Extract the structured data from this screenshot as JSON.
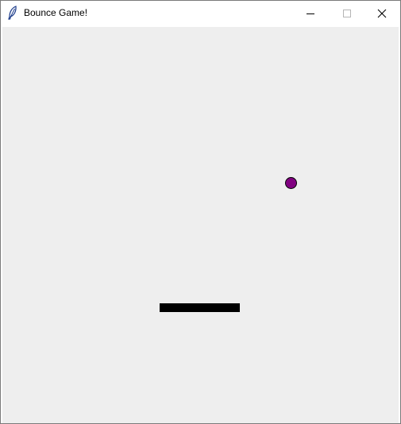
{
  "window": {
    "title": "Bounce Game!",
    "controls": {
      "minimize_icon": "minimize-icon",
      "maximize_icon": "maximize-icon",
      "close_icon": "close-icon"
    }
  },
  "game": {
    "canvas_color": "#eeeeee",
    "ball": {
      "color": "#800080",
      "outline": "#000000"
    },
    "paddle": {
      "color": "#000000"
    }
  }
}
